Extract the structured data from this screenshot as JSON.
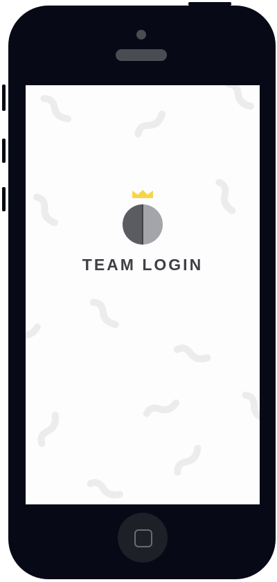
{
  "app": {
    "title": "TEAM LOGIN"
  },
  "colors": {
    "crown": "#f7d54a",
    "circle_left": "#5b5c61",
    "circle_right": "#a3a5aa",
    "title": "#3f4046",
    "pattern": "#ececec",
    "phone_body": "#070a16",
    "screen": "#fdfdfd"
  },
  "icons": {
    "crown": "crown-icon",
    "logo": "split-circle-logo-icon",
    "home": "home-button-icon"
  }
}
